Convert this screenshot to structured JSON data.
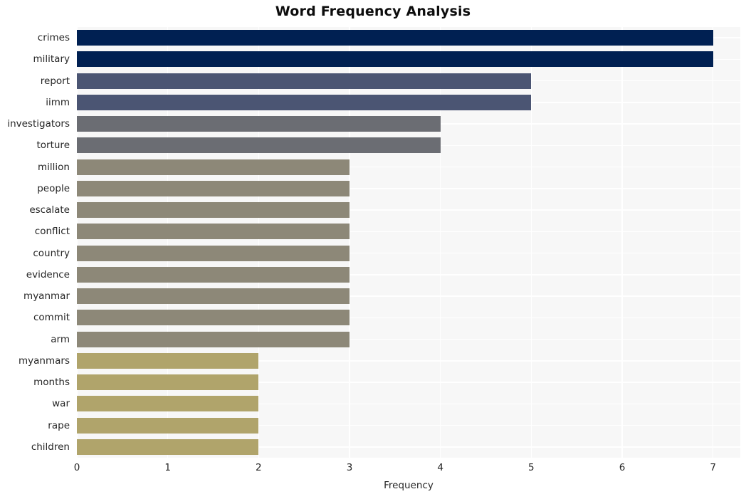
{
  "chart_data": {
    "type": "bar",
    "orientation": "horizontal",
    "title": "Word Frequency Analysis",
    "xlabel": "Frequency",
    "ylabel": "",
    "xlim": [
      0,
      7.3
    ],
    "xticks": [
      "0",
      "1",
      "2",
      "3",
      "4",
      "5",
      "6",
      "7"
    ],
    "xtick_values": [
      0,
      1,
      2,
      3,
      4,
      5,
      6,
      7
    ],
    "grid": true,
    "legend": "none",
    "categories": [
      "crimes",
      "military",
      "report",
      "iimm",
      "investigators",
      "torture",
      "million",
      "people",
      "escalate",
      "conflict",
      "country",
      "evidence",
      "myanmar",
      "commit",
      "arm",
      "myanmars",
      "months",
      "war",
      "rape",
      "children"
    ],
    "values": [
      7,
      7,
      5,
      5,
      4,
      4,
      3,
      3,
      3,
      3,
      3,
      3,
      3,
      3,
      3,
      2,
      2,
      2,
      2,
      2
    ],
    "bar_colors": [
      "#002052",
      "#002052",
      "#4b5573",
      "#4b5573",
      "#6b6d73",
      "#6b6d73",
      "#8d8878",
      "#8d8878",
      "#8d8878",
      "#8d8878",
      "#8d8878",
      "#8d8878",
      "#8d8878",
      "#8d8878",
      "#8d8878",
      "#b0a46b",
      "#b0a46b",
      "#b0a46b",
      "#b0a46b",
      "#b0a46b"
    ],
    "plot_background": "#f7f7f7",
    "figure_background": "#ffffff",
    "grid_color": "#ffffff",
    "text_color": "#262626"
  }
}
